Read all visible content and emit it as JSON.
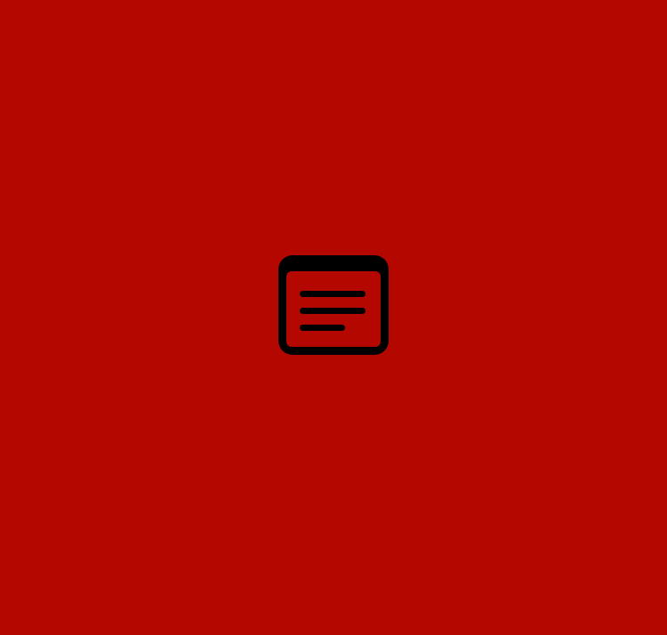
{
  "screen": {
    "background_color": "#b30700",
    "icon": {
      "name": "document-window-icon",
      "color": "#000000"
    }
  }
}
